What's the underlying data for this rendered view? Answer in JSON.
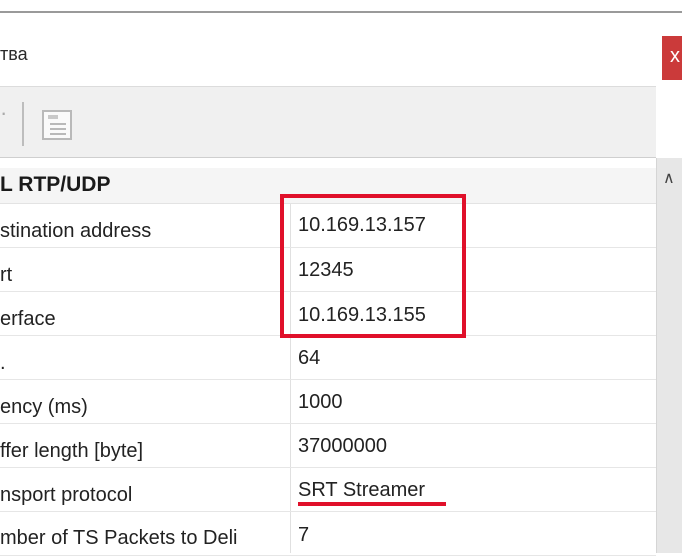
{
  "window": {
    "title_fragment": "тва",
    "close_glyph": "x"
  },
  "grid": {
    "category": "L RTP/UDP",
    "rows": [
      {
        "name": "stination address",
        "value": "10.169.13.157"
      },
      {
        "name": "rt",
        "value": "12345"
      },
      {
        "name": "erface",
        "value": "10.169.13.155"
      },
      {
        "name": ".",
        "value": "64"
      },
      {
        "name": "ency (ms)",
        "value": "1000"
      },
      {
        "name": "ffer length [byte]",
        "value": "37000000"
      },
      {
        "name": "nsport protocol",
        "value": "SRT Streamer"
      },
      {
        "name": "mber of TS Packets to Deli",
        "value": "7"
      }
    ]
  },
  "annotations": {
    "highlight_color": "#e0102a"
  }
}
